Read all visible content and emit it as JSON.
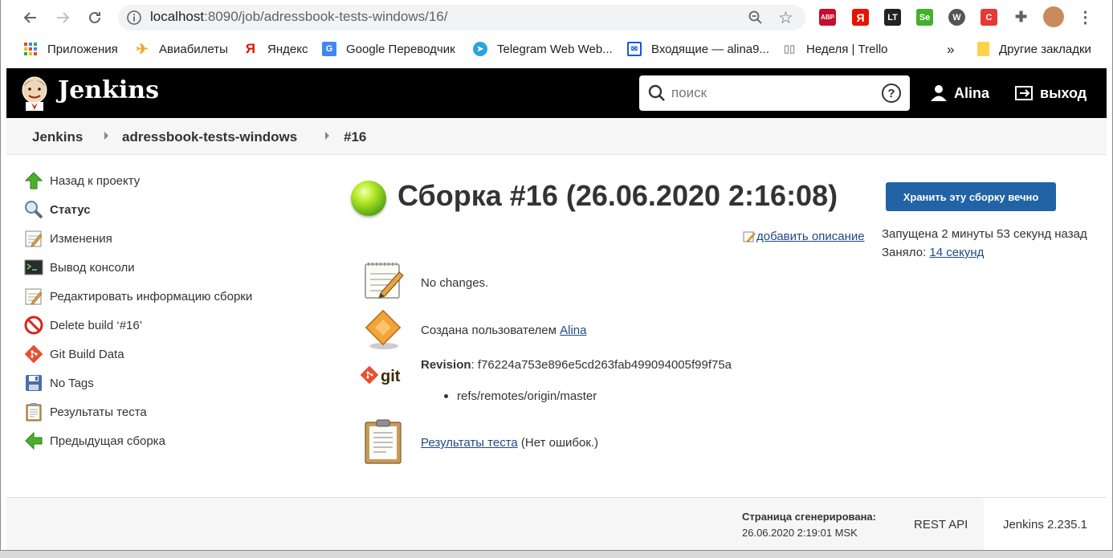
{
  "browser": {
    "url_host": "localhost",
    "url_path": ":8090/job/adressbook-tests-windows/16/",
    "extensions": [
      {
        "name": "adblock-plus-icon",
        "label": "ABP",
        "color": "#c70d2c"
      },
      {
        "name": "yandex-icon",
        "label": "Я",
        "color": "#e61400"
      },
      {
        "name": "languagetool-icon",
        "label": "LT",
        "color": "#222222"
      },
      {
        "name": "selenium-icon",
        "label": "Se",
        "color": "#43b02a"
      },
      {
        "name": "w-extension-icon",
        "label": "W",
        "color": "#555555"
      },
      {
        "name": "red-extension-icon",
        "label": "C",
        "color": "#e53935"
      }
    ],
    "bookmarks": [
      {
        "label": "Приложения",
        "icon": "apps-grid-icon"
      },
      {
        "label": "Авиабилеты",
        "icon": "airplane-icon"
      },
      {
        "label": "Яндекс",
        "icon": "yandex-icon"
      },
      {
        "label": "Google Переводчик",
        "icon": "google-translate-icon"
      },
      {
        "label": "Telegram Web Web...",
        "icon": "telegram-icon"
      },
      {
        "label": "Входящие — alina9...",
        "icon": "mail-icon"
      },
      {
        "label": "Неделя | Trello",
        "icon": "trello-icon"
      }
    ],
    "more_bookmarks": "»",
    "other_bookmarks": "Другие закладки"
  },
  "header": {
    "title": "Jenkins",
    "search_placeholder": "поиск",
    "user": "Alina",
    "logout": "выход"
  },
  "breadcrumbs": [
    "Jenkins",
    "adressbook-tests-windows",
    "#16"
  ],
  "sidebar": {
    "items": [
      {
        "label": "Назад к проекту",
        "icon": "arrow-up-icon"
      },
      {
        "label": "Статус",
        "icon": "magnifier-icon",
        "active": true
      },
      {
        "label": "Изменения",
        "icon": "notepad-icon"
      },
      {
        "label": "Вывод консоли",
        "icon": "terminal-icon"
      },
      {
        "label": "Редактировать информацию сборки",
        "icon": "notepad-edit-icon"
      },
      {
        "label": "Delete build ‘#16’",
        "icon": "no-entry-icon"
      },
      {
        "label": "Git Build Data",
        "icon": "git-icon"
      },
      {
        "label": "No Tags",
        "icon": "save-icon"
      },
      {
        "label": "Результаты теста",
        "icon": "clipboard-icon"
      },
      {
        "label": "Предыдущая сборка",
        "icon": "arrow-left-icon"
      }
    ]
  },
  "build": {
    "status_color": "#6bbf17",
    "title": "Сборка #16 (26.06.2020 2:16:08)",
    "keep_button": "Хранить эту сборку вечно",
    "add_description": "добавить описание",
    "started": "Запущена 2 минуты 53 секунд назад",
    "took_label": "Заняло: ",
    "took_value": "14 секунд",
    "changes": "No changes.",
    "created_by_label": "Создана пользователем ",
    "created_by_user": "Alina",
    "revision_label": "Revision",
    "revision_value": ": f76224a753e896e5cd263fab499094005f99f75a",
    "ref": "refs/remotes/origin/master",
    "test_results_link": "Результаты теста",
    "test_results_note": " (Нет ошибок.)"
  },
  "footer": {
    "generated_label": "Страница сгенерирована:",
    "generated_time": "26.06.2020 2:19:01 MSK",
    "rest_api": "REST API",
    "version": "Jenkins 2.235.1"
  }
}
